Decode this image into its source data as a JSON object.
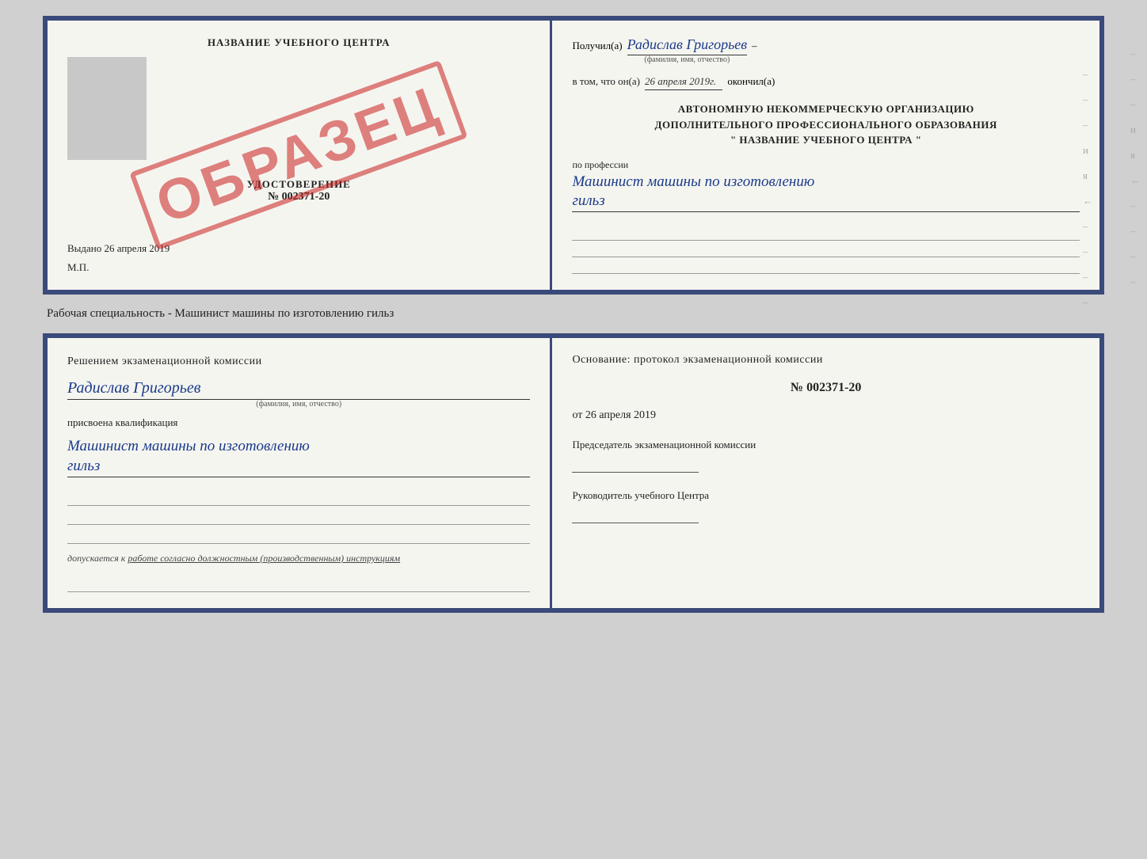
{
  "top_cert": {
    "left": {
      "title": "НАЗВАНИЕ УЧЕБНОГО ЦЕНТРА",
      "stamp_text": "ОБРАЗЕЦ",
      "udost_label": "УДОСТОВЕРЕНИЕ",
      "udost_number": "№ 002371-20",
      "vydano_label": "Выдано",
      "vydano_date": "26 апреля 2019",
      "mp_label": "М.П."
    },
    "right": {
      "poluchil_label": "Получил(а)",
      "person_name": "Радислав Григорьев",
      "fio_subtitle": "(фамилия, имя, отчество)",
      "dash": "–",
      "vtom_label": "в том, что он(а)",
      "vtom_date": "26 апреля 2019г.",
      "okonchill_label": "окончил(а)",
      "org_line1": "АВТОНОМНУЮ НЕКОММЕРЧЕСКУЮ ОРГАНИЗАЦИЮ",
      "org_line2": "ДОПОЛНИТЕЛЬНОГО ПРОФЕССИОНАЛЬНОГО ОБРАЗОВАНИЯ",
      "org_line3": "\"  НАЗВАНИЕ УЧЕБНОГО ЦЕНТРА  \"",
      "po_professii_label": "по профессии",
      "profession_name": "Машинист машины по изготовлению",
      "profession_name2": "гильз"
    }
  },
  "specialist_label": "Рабочая специальность - Машинист машины по изготовлению гильз",
  "bottom_cert": {
    "left": {
      "komissia_text": "Решением  экзаменационной  комиссии",
      "person_name": "Радислав Григорьев",
      "fio_subtitle": "(фамилия, имя, отчество)",
      "prisvoena_label": "присвоена квалификация",
      "kvali_name": "Машинист машины по изготовлению",
      "kvali_name2": "гильз",
      "dopuskaetsya_prefix": "допускается к",
      "dopuskaetsya_text": "работе согласно должностным (производственным) инструкциям"
    },
    "right": {
      "osnov_label": "Основание: протокол экзаменационной  комиссии",
      "proto_number": "№  002371-20",
      "ot_label": "от",
      "proto_date": "26 апреля 2019",
      "predsedatel_label": "Председатель экзаменационной комиссии",
      "rukovoditel_label": "Руководитель учебного Центра"
    }
  },
  "dashes": {
    "items": [
      "–",
      "–",
      "–",
      "и",
      "я",
      "←",
      "–",
      "–",
      "–",
      "–",
      "–",
      "–",
      "–",
      "и",
      "я",
      "←",
      "–",
      "–",
      "–",
      "–"
    ]
  }
}
